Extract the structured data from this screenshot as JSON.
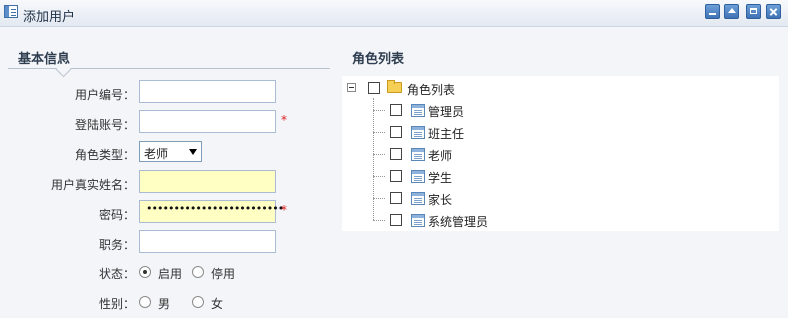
{
  "window": {
    "title": "添加用户"
  },
  "basic_info": {
    "heading": "基本信息",
    "user_id": {
      "label": "用户编号：",
      "value": ""
    },
    "login_account": {
      "label": "登陆账号：",
      "value": "",
      "required_mark": "*"
    },
    "role_type": {
      "label": "角色类型：",
      "selected": "老师"
    },
    "real_name": {
      "label": "用户真实姓名：",
      "value": ""
    },
    "password": {
      "label": "密码：",
      "masked_value": "•••••••••••••••••••••••••",
      "required_mark": "*"
    },
    "position": {
      "label": "职务：",
      "value": ""
    },
    "status": {
      "label": "状态：",
      "options": [
        "启用",
        "停用"
      ],
      "selected": "启用"
    },
    "gender": {
      "label": "性别：",
      "options": [
        "男",
        "女"
      ],
      "selected": ""
    }
  },
  "role_list": {
    "heading": "角色列表",
    "root": {
      "label": "角色列表",
      "checked": false
    },
    "items": [
      {
        "label": "管理员",
        "checked": false
      },
      {
        "label": "班主任",
        "checked": false
      },
      {
        "label": "老师",
        "checked": false
      },
      {
        "label": "学生",
        "checked": false
      },
      {
        "label": "家长",
        "checked": false
      },
      {
        "label": "系统管理员",
        "checked": false
      }
    ]
  },
  "colors": {
    "required": "#e02020",
    "highlight_input": "#ffffc4",
    "accent": "#3f72b5"
  }
}
